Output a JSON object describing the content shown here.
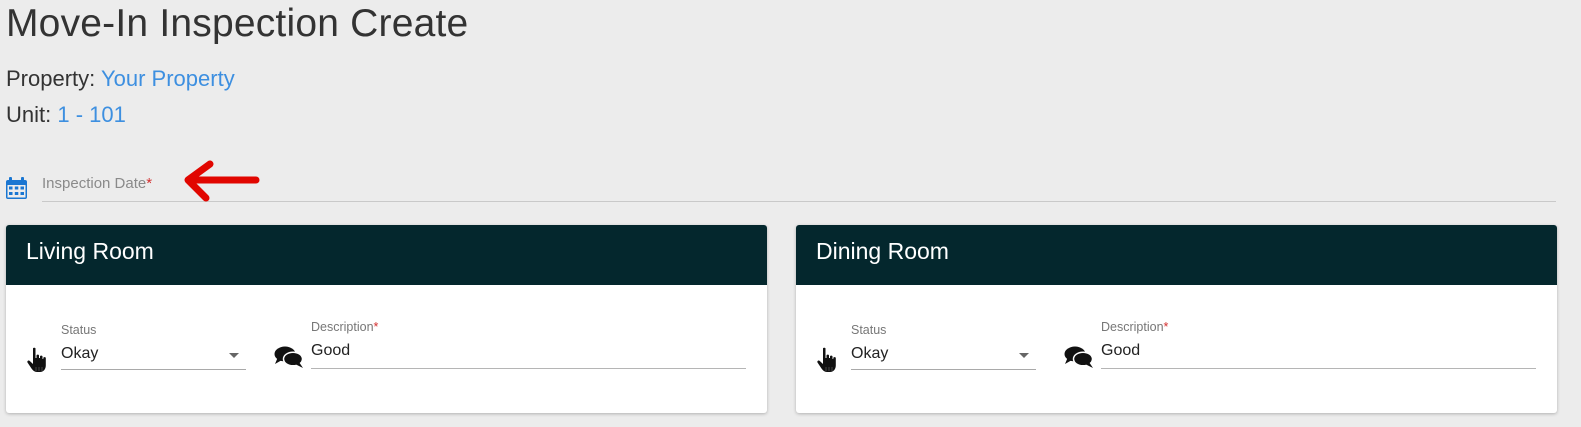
{
  "page": {
    "title": "Move-In Inspection Create"
  },
  "property": {
    "label": "Property:",
    "value": "Your Property"
  },
  "unit": {
    "label": "Unit:",
    "value": "1 - 101"
  },
  "inspection_date": {
    "label": "Inspection Date",
    "required_mark": "*",
    "icon": "calendar-icon"
  },
  "annotation": {
    "icon": "red-arrow-left",
    "color": "#e10600"
  },
  "colors": {
    "accent_link": "#3d8fe0",
    "card_header": "#04272d",
    "required": "#d32f2f",
    "background": "#ececec"
  },
  "rooms": [
    {
      "name": "Living Room",
      "status_label": "Status",
      "status_value": "Okay",
      "description_label": "Description",
      "description_required": "*",
      "description_value": "Good"
    },
    {
      "name": "Dining Room",
      "status_label": "Status",
      "status_value": "Okay",
      "description_label": "Description",
      "description_required": "*",
      "description_value": "Good"
    }
  ]
}
